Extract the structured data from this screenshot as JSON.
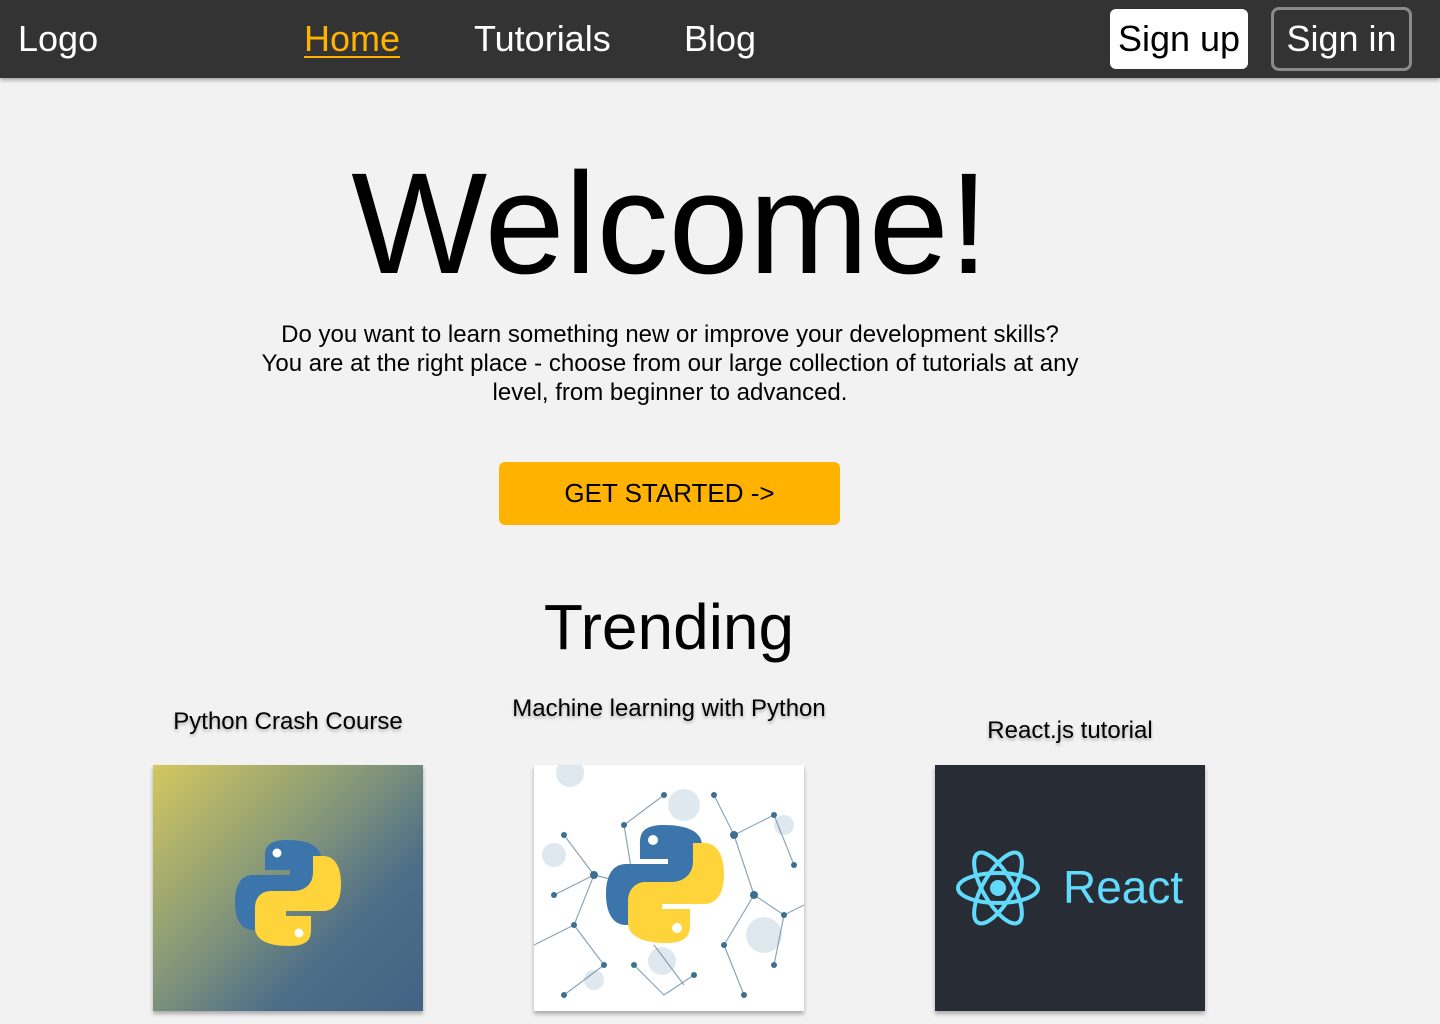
{
  "nav": {
    "logo": "Logo",
    "links": [
      {
        "label": "Home",
        "active": true
      },
      {
        "label": "Tutorials",
        "active": false
      },
      {
        "label": "Blog",
        "active": false
      }
    ],
    "signup_label": "Sign up",
    "signin_label": "Sign in"
  },
  "hero": {
    "title": "Welcome!",
    "text": "Do you want to learn something new or improve your development skills? You are at the right place - choose from our large collection of tutorials at any level, from beginner to advanced.",
    "cta_label": "GET STARTED ->"
  },
  "trending": {
    "title": "Trending",
    "cards": [
      {
        "title": "Python Crash Course",
        "icon": "python-logo-icon"
      },
      {
        "title": "Machine learning with Python",
        "icon": "python-network-icon"
      },
      {
        "title": "React.js tutorial",
        "icon": "react-logo-icon",
        "wordmark": "React"
      }
    ]
  },
  "colors": {
    "navbar": "#333333",
    "accent": "#ffb300",
    "background": "#f2f2f2",
    "react_blue": "#61dafb",
    "python_blue": "#3b75ab",
    "python_yellow": "#ffd43b"
  }
}
